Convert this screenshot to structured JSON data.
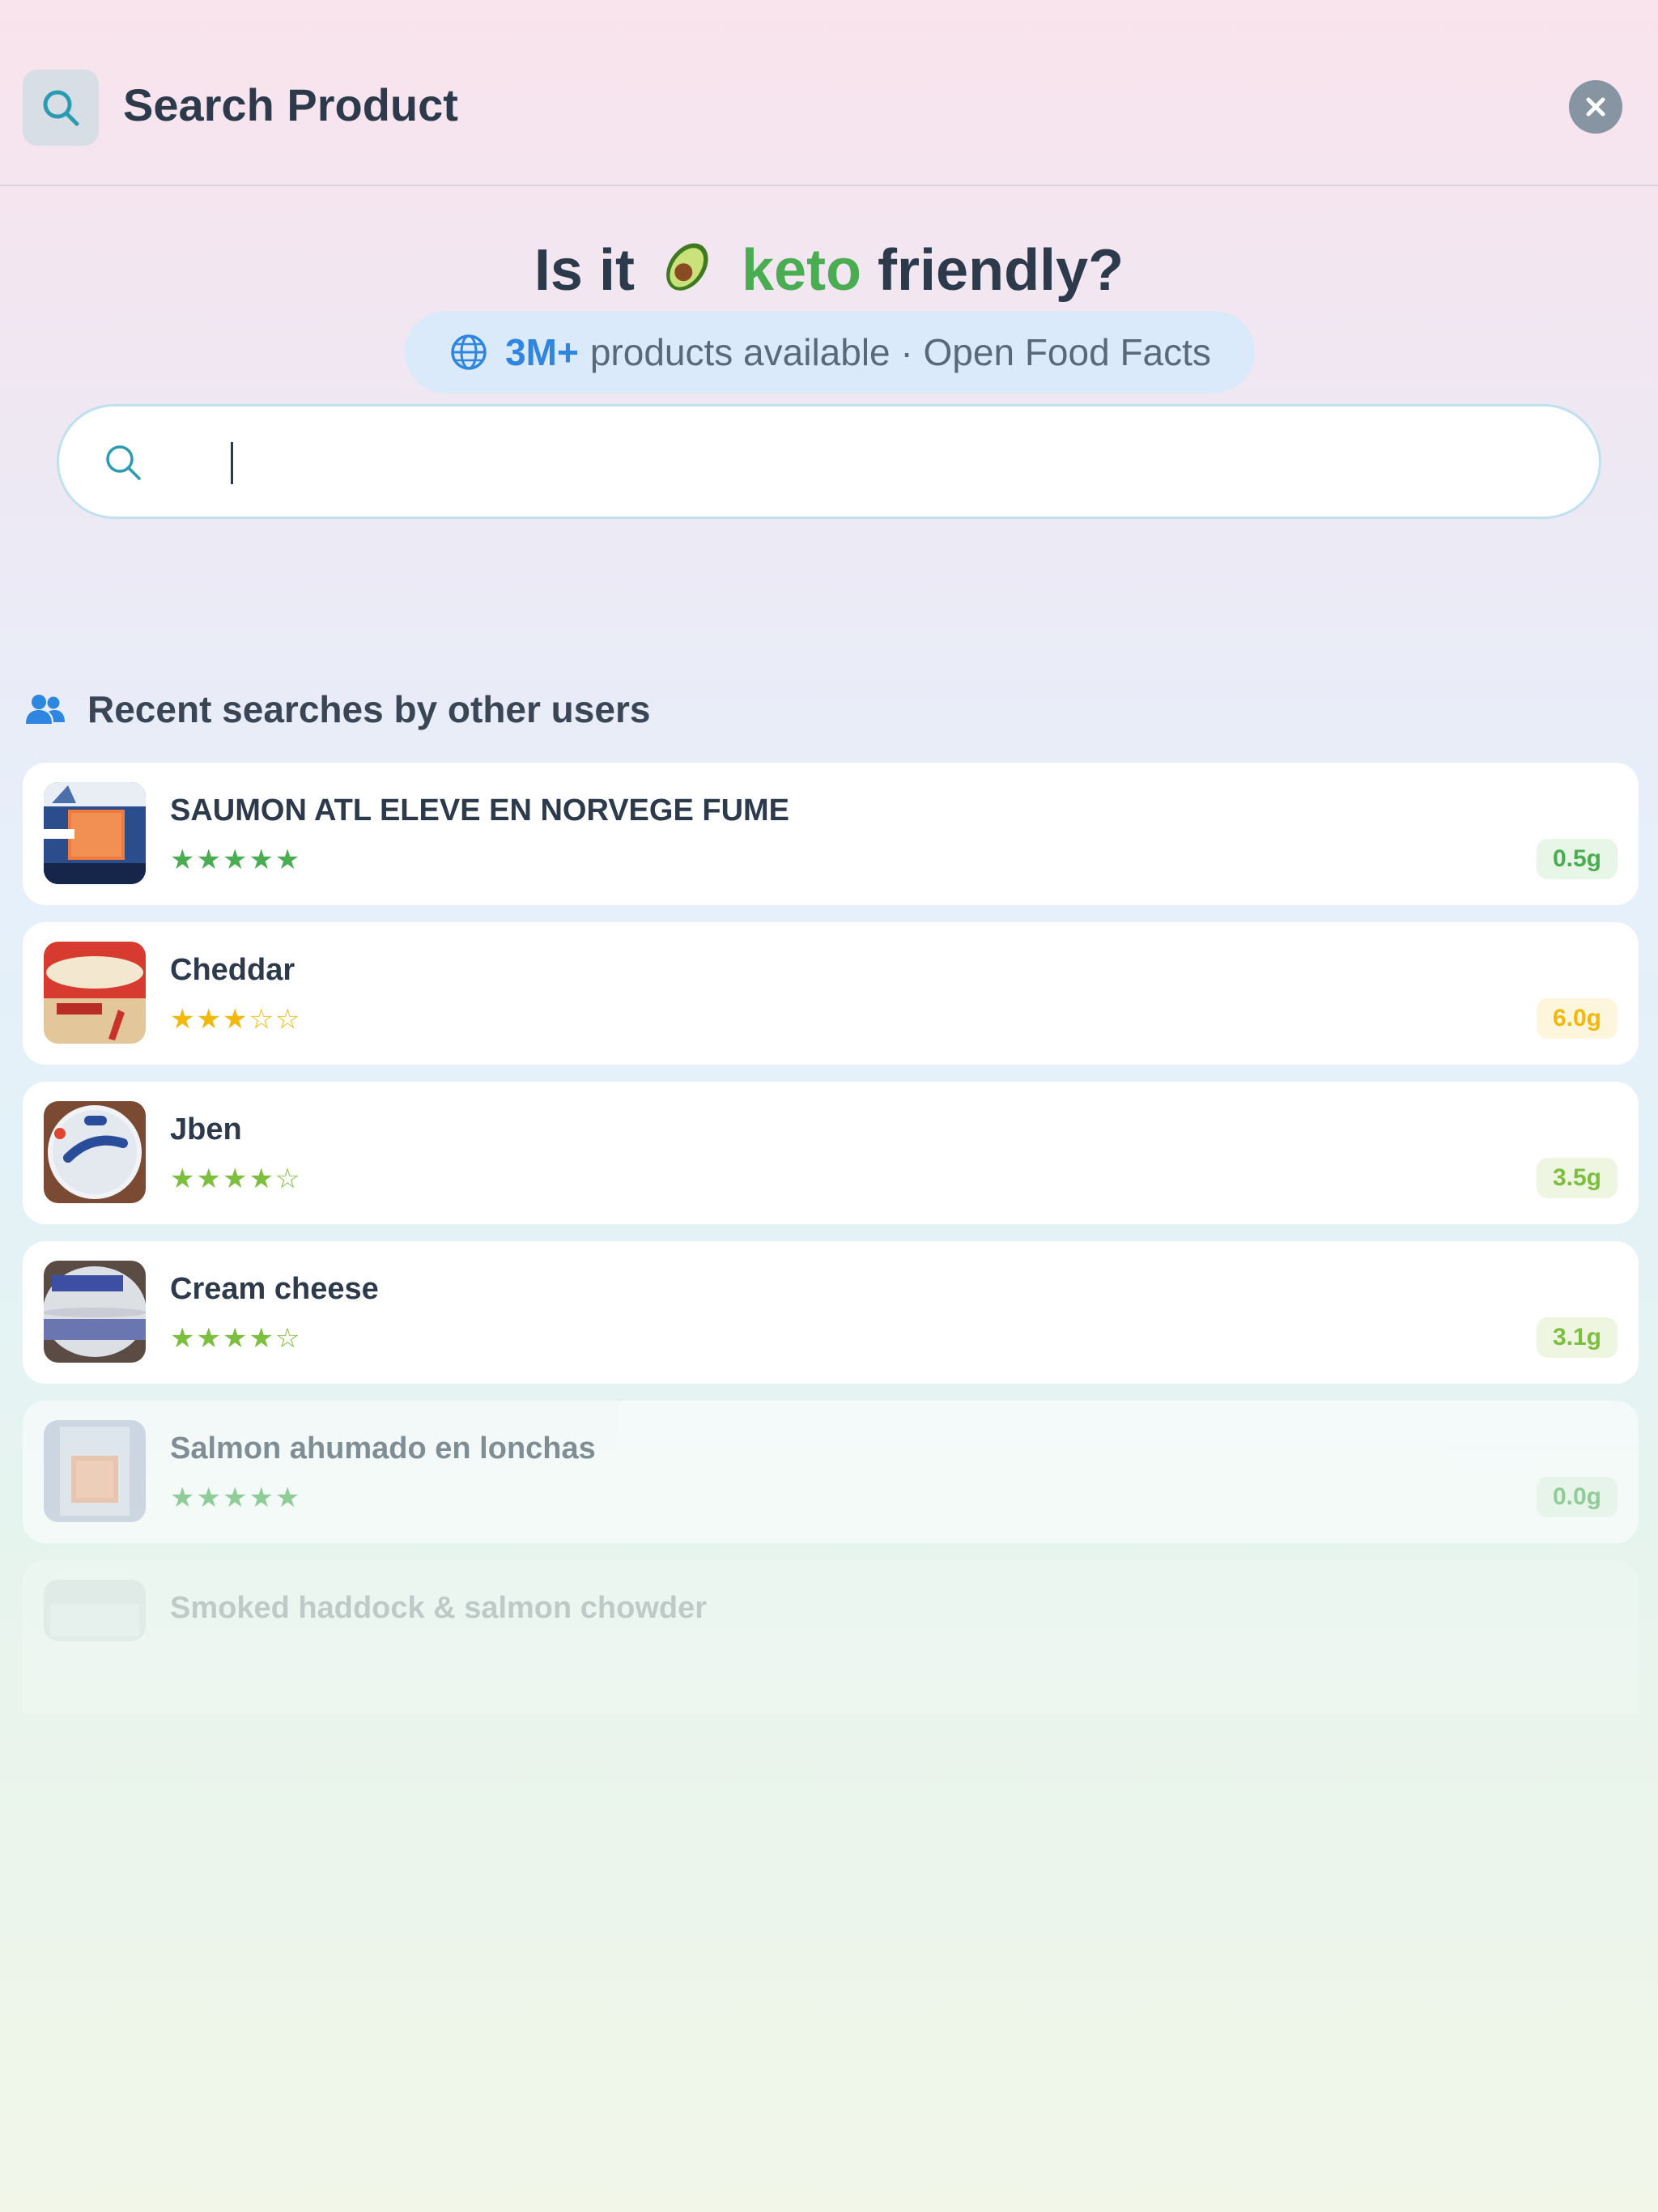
{
  "header": {
    "title": "Search Product",
    "search_icon": "search-icon",
    "close_icon": "close-icon"
  },
  "hero": {
    "prefix": "Is it",
    "emoji_icon": "avocado-icon",
    "highlight": "keto",
    "suffix": "friendly?"
  },
  "availability": {
    "icon": "globe-icon",
    "count": "3M+",
    "text": "products available · Open Food Facts"
  },
  "search": {
    "value": "",
    "placeholder": ""
  },
  "recent": {
    "icon": "users-icon",
    "title": "Recent searches by other users",
    "items": [
      {
        "name": "SAUMON ATL ELEVE EN NORVEGE FUME",
        "rating": 5,
        "stars": "★★★★★",
        "carbs": "0.5g",
        "tone": "green"
      },
      {
        "name": "Cheddar",
        "rating": 3,
        "stars": "★★★☆☆",
        "carbs": "6.0g",
        "tone": "yellow"
      },
      {
        "name": "Jben",
        "rating": 4,
        "stars": "★★★★☆",
        "carbs": "3.5g",
        "tone": "lime"
      },
      {
        "name": "Cream cheese",
        "rating": 4,
        "stars": "★★★★☆",
        "carbs": "3.1g",
        "tone": "lime"
      },
      {
        "name": "Salmon ahumado en lonchas",
        "rating": 5,
        "stars": "★★★★★",
        "carbs": "0.0g",
        "tone": "green"
      },
      {
        "name": "Smoked haddock & salmon chowder"
      }
    ]
  },
  "colors": {
    "keto_green": "#4aad52",
    "accent_blue": "#2f86e0",
    "rating_green": "#4aad52",
    "rating_yellow": "#f2b80d",
    "rating_lime": "#7cbe3d"
  }
}
